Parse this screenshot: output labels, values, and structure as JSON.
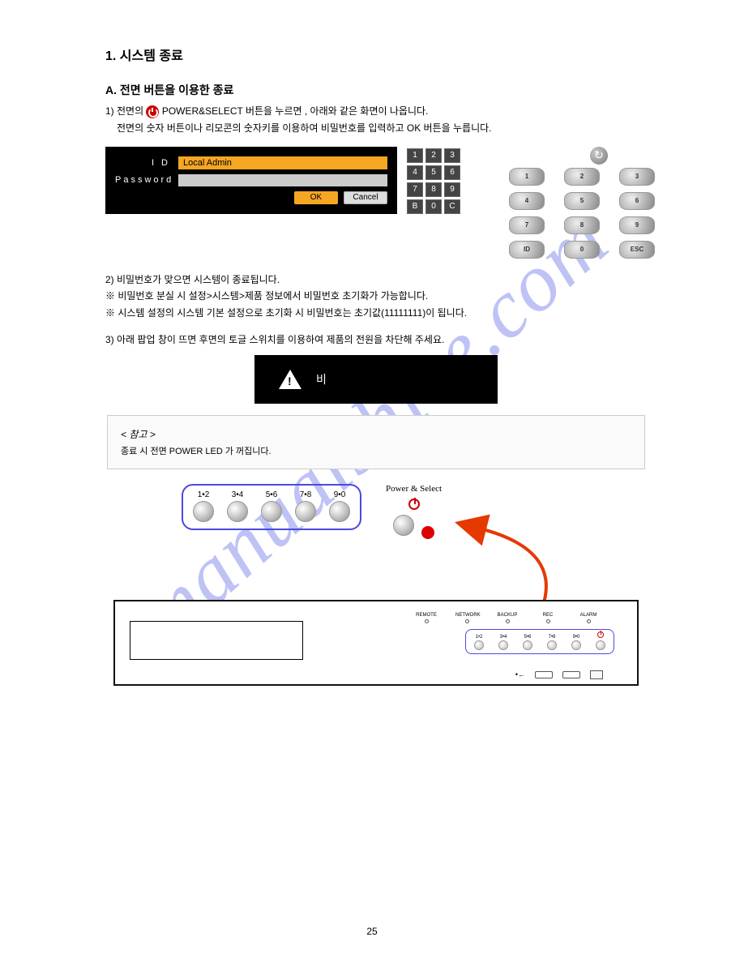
{
  "sections": {
    "heading_main": "1. 시스템 종료",
    "heading_a": "A. 전면 버튼을 이용한 종료",
    "step1_label": "1)",
    "step1_prefix": "전면의 ",
    "step1_after_icon1": " POWER&SELECT 버튼을 누르면",
    "step1_cont": ", 아래와 같은 화면이 나옵니다.",
    "step1_extra": "전면의 숫자 버튼이나 리모콘의 숫자키를 이용하여 비밀번호를 입력하고 OK 버튼을 누릅니다.",
    "step2_label": "2)",
    "step2_text": "비밀번호가 맞으면 시스템이 종료됩니다.",
    "note1": "※ 비밀번호 분실 시 설정>시스템>제품 정보에서 비밀번호 초기화가 가능합니다.",
    "note2": "※ 시스템 설정의 시스템 기본 설정으로 초기화 시 비밀번호는 초기값(11111111)이 됩니다.",
    "step3_label": "3)",
    "step3_text": "아래 팝업 창이 뜨면 후면의 토글 스위치를 이용하여 제품의 전원을 차단해 주세요."
  },
  "dialog": {
    "id_label": "I      D",
    "pw_label": "Password",
    "id_value": "Local Admin",
    "ok": "OK",
    "cancel": "Cancel"
  },
  "keypad1": [
    "1",
    "2",
    "3",
    "4",
    "5",
    "6",
    "7",
    "8",
    "9",
    "B",
    "0",
    "C"
  ],
  "keypad2": [
    "1",
    "2",
    "3",
    "4",
    "5",
    "6",
    "7",
    "8",
    "9",
    "ID",
    "0",
    "ESC"
  ],
  "warn": {
    "text": "비"
  },
  "grey": {
    "title": "< 참고 >",
    "text": "종료 시 전면 POWER LED 가 꺼집니다."
  },
  "diagram": {
    "labels": [
      "1•2",
      "3•4",
      "5•6",
      "7•8",
      "9•0"
    ],
    "power_label": "Power & Select",
    "status_leds": [
      "REMOTE",
      "NETWORK",
      "BACKUP",
      "REC",
      "ALARM"
    ],
    "front_buttons": [
      "1•2",
      "3•4",
      "5•6",
      "7•8",
      "9•0"
    ],
    "power_sym": "⏻",
    "usb_sym": "•←"
  },
  "page_number": "25"
}
